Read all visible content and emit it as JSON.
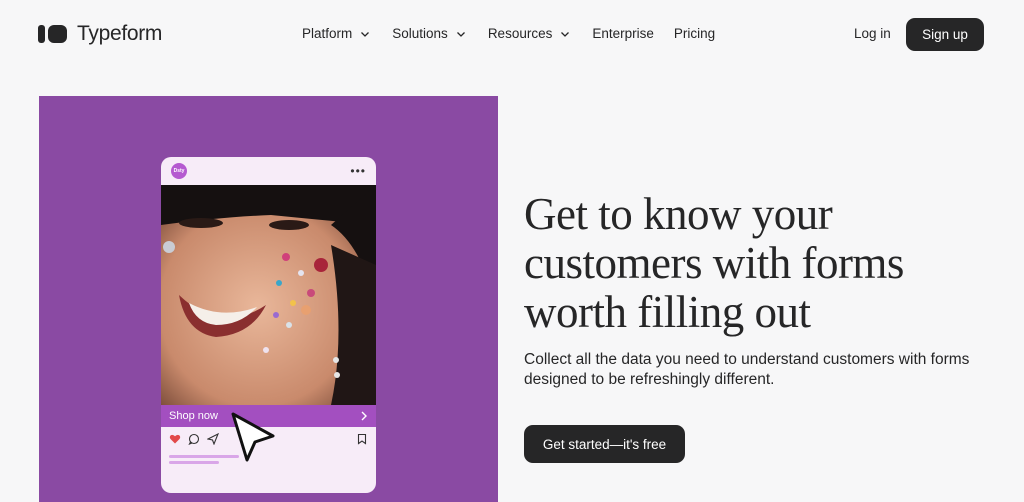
{
  "brand": {
    "name": "Typeform"
  },
  "nav": {
    "items": [
      {
        "label": "Platform",
        "has_dropdown": true
      },
      {
        "label": "Solutions",
        "has_dropdown": true
      },
      {
        "label": "Resources",
        "has_dropdown": true
      },
      {
        "label": "Enterprise",
        "has_dropdown": false
      },
      {
        "label": "Pricing",
        "has_dropdown": false
      }
    ],
    "login_label": "Log in",
    "signup_label": "Sign up"
  },
  "hero": {
    "headline": "Get to know your customers with forms worth filling out",
    "subtext": "Collect all the data you need to understand customers with forms designed to be refreshingly different.",
    "cta_label": "Get started—it's free",
    "panel_color": "#8a4aa3",
    "mockup": {
      "avatar_text": "Dsty",
      "shop_label": "Shop now",
      "icons": [
        "heart-icon",
        "comment-icon",
        "send-icon",
        "bookmark-icon"
      ]
    }
  },
  "colors": {
    "dark": "#262627",
    "background": "#f7f7f8",
    "accent_purple": "#8a4aa3"
  }
}
